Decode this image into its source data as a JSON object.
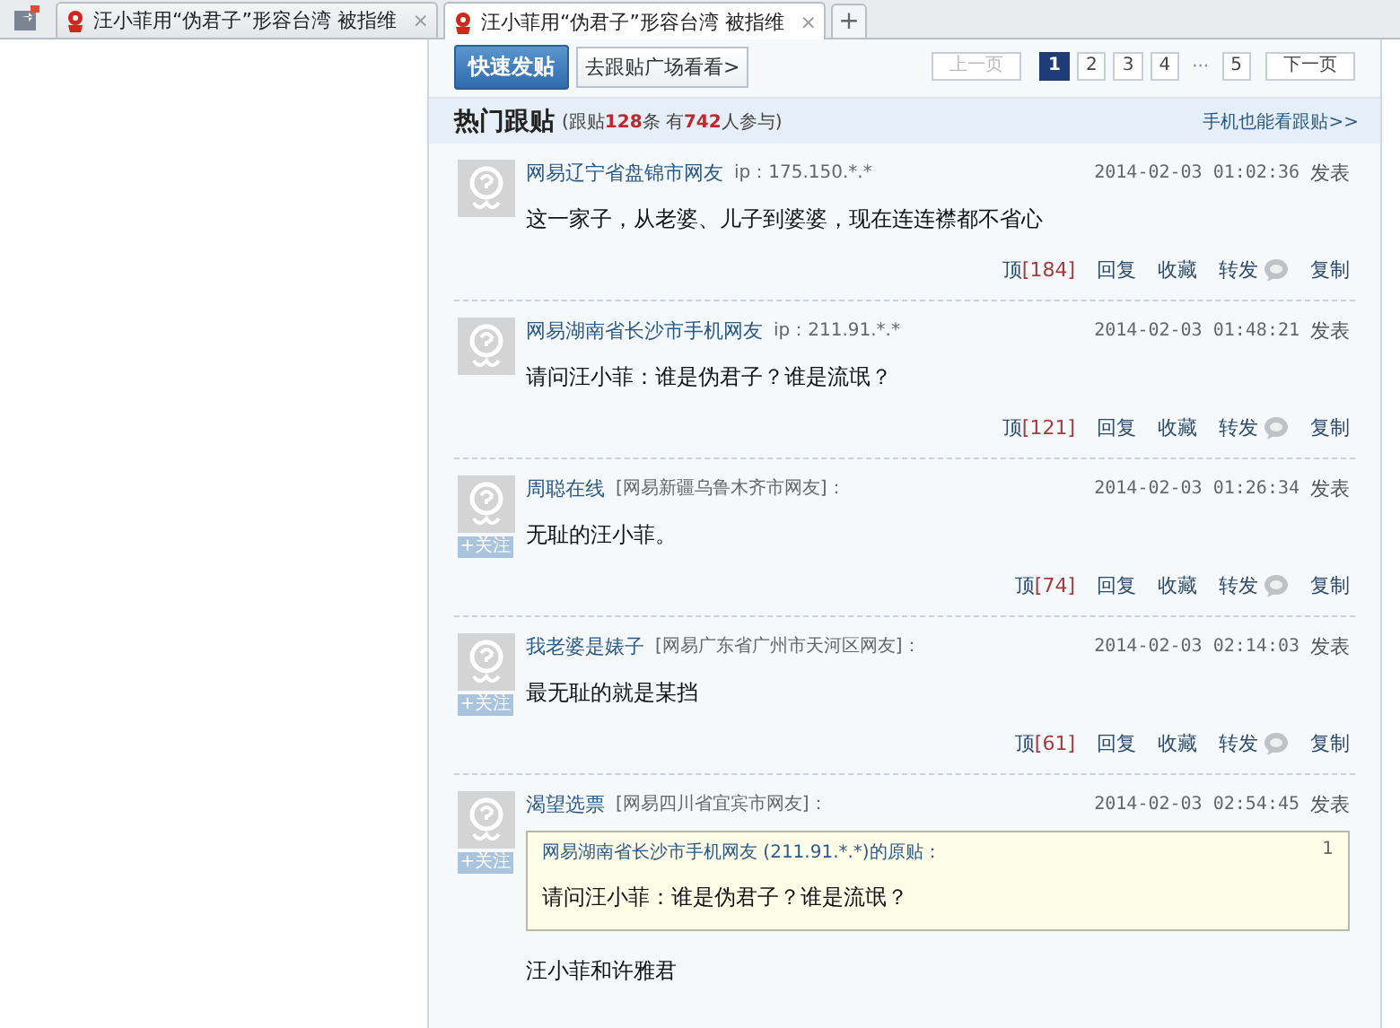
{
  "tabs": [
    {
      "title": "汪小菲用“伪君子”形容台湾 被指维",
      "close": "×",
      "selected": false
    },
    {
      "title": "汪小菲用“伪君子”形容台湾 被指维",
      "close": "×",
      "selected": true
    }
  ],
  "new_tab": "+",
  "toolbar": {
    "post_button": "快速发贴",
    "plaza_link": "去跟贴广场看看>"
  },
  "pager": {
    "prev": {
      "label": "上一页",
      "disabled": true
    },
    "pages": [
      {
        "kind": "page",
        "label": "1",
        "selected": true
      },
      {
        "kind": "page",
        "label": "2",
        "selected": false
      },
      {
        "kind": "page",
        "label": "3",
        "selected": false
      },
      {
        "kind": "page",
        "label": "4",
        "selected": false
      },
      {
        "kind": "ellipsis",
        "label": "···"
      },
      {
        "kind": "page",
        "label": "5",
        "selected": false
      }
    ],
    "next": {
      "label": "下一页",
      "disabled": false
    }
  },
  "header": {
    "title": "热门跟贴",
    "stats": "(跟贴**128**条 有**742**人参与)",
    "mobile_link": "手机也能看跟贴>>"
  },
  "posts": [
    {
      "author": "网易辽宁省盘锦市网友",
      "meta": "ip：175.150.*.*",
      "time": "2014-02-03 01:02:36",
      "posted": "发表",
      "body": "这一家子，从老婆、儿子到婆婆，现在连连襟都不省心",
      "actions": {
        "vote": "顶",
        "count": "[184]",
        "reply": "回复",
        "favorite": "收藏",
        "share": "转发",
        "copy": "复制"
      }
    },
    {
      "author": "网易湖南省长沙市手机网友",
      "meta": "ip：211.91.*.*",
      "time": "2014-02-03 01:48:21",
      "posted": "发表",
      "body": "请问汪小菲：谁是伪君子？谁是流氓？",
      "actions": {
        "vote": "顶",
        "count": "[121]",
        "reply": "回复",
        "favorite": "收藏",
        "share": "转发",
        "copy": "复制"
      }
    },
    {
      "author": "周聪在线",
      "meta": "[网易新疆乌鲁木齐市网友]：",
      "follow": "+关注",
      "time": "2014-02-03 01:26:34",
      "posted": "发表",
      "body": "无耻的汪小菲。",
      "actions": {
        "vote": "顶",
        "count": "[74]",
        "reply": "回复",
        "favorite": "收藏",
        "share": "转发",
        "copy": "复制"
      }
    },
    {
      "author": "我老婆是婊子",
      "meta": "[网易广东省广州市天河区网友]：",
      "follow": "+关注",
      "time": "2014-02-03 02:14:03",
      "posted": "发表",
      "body": "最无耻的就是某挡",
      "actions": {
        "vote": "顶",
        "count": "[61]",
        "reply": "回复",
        "favorite": "收藏",
        "share": "转发",
        "copy": "复制"
      }
    },
    {
      "author": "渴望选票",
      "meta": "[网易四川省宜宾市网友]：",
      "follow": "+关注",
      "time": "2014-02-03 02:54:45",
      "posted": "发表",
      "quote": {
        "source": "网易湖南省长沙市手机网友 (211.91.*.*)的原贴：",
        "floor": "1",
        "text": "请问汪小菲：谁是伪君子？谁是流氓？"
      },
      "body": "汪小菲和许雅君"
    }
  ]
}
